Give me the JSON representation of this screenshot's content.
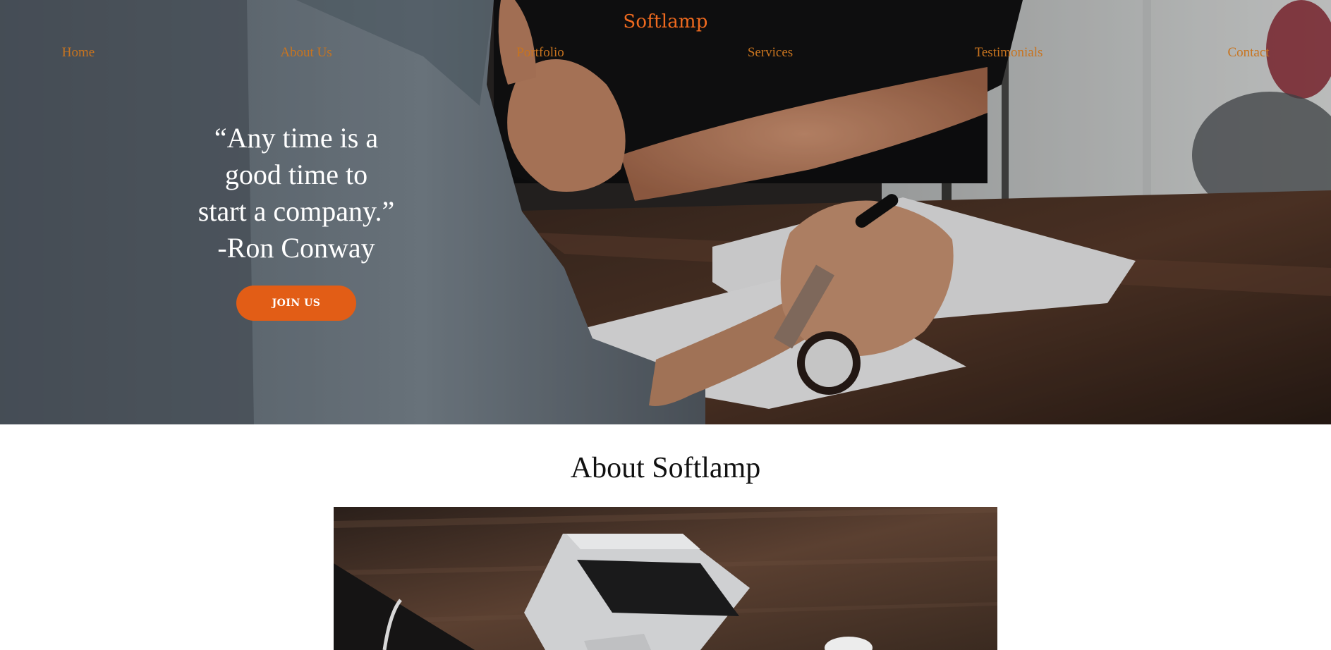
{
  "site": {
    "brand": "Softlamp"
  },
  "nav": {
    "items": [
      {
        "label": "Home"
      },
      {
        "label": "About Us"
      },
      {
        "label": "Portfolio"
      },
      {
        "label": "Services"
      },
      {
        "label": "Testimonials"
      },
      {
        "label": "Contact"
      }
    ]
  },
  "hero": {
    "quote_lines": [
      "“Any time is a",
      "good time to",
      "start a company.”",
      "-Ron Conway"
    ],
    "button_label": "JOIN US",
    "background_image": "photo-two-people-meeting-at-wooden-desk-with-papers-and-wristwatch"
  },
  "about": {
    "title": "About Softlamp",
    "image": "photo-laptop-on-wooden-desk"
  },
  "colors": {
    "brand": "#ef6a1f",
    "nav_link": "#c8741f",
    "button": "#e25d16",
    "heading": "#111111"
  }
}
